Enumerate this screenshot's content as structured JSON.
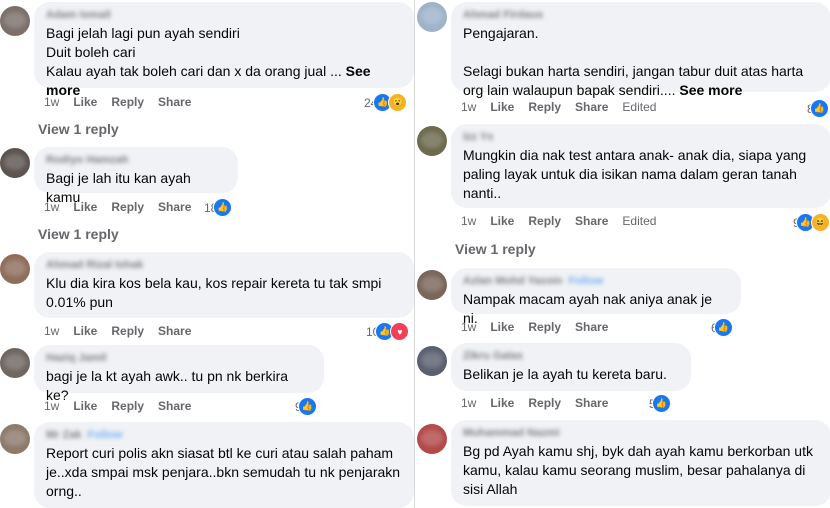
{
  "left": {
    "comments": [
      {
        "text": "Bagi jelah lagi pun ayah sendiri\nDuit boleh cari\nKalau ayah tak boleh cari dan x da orang jual ... ",
        "see_more": "See more",
        "age": "1w",
        "like": "Like",
        "reply": "Share",
        "reply_label": "Reply",
        "react_count": "24",
        "reacts": [
          "like",
          "wow"
        ],
        "view_reply": "View 1 reply"
      },
      {
        "text": "Bagi je lah itu kan ayah kamu",
        "age": "1w",
        "like": "Like",
        "reply_label": "Reply",
        "share": "Share",
        "react_count": "18",
        "reacts": [
          "like"
        ],
        "view_reply": "View 1 reply"
      },
      {
        "text": "Klu dia kira kos bela kau, kos repair kereta tu tak smpi\n0.01% pun",
        "age": "1w",
        "like": "Like",
        "reply_label": "Reply",
        "share": "Share",
        "react_count": "10",
        "reacts": [
          "like",
          "heart"
        ]
      },
      {
        "text": "bagi je la kt ayah awk.. tu pn nk berkira ke?",
        "age": "1w",
        "like": "Like",
        "reply_label": "Reply",
        "share": "Share",
        "react_count": "9",
        "reacts": [
          "like"
        ]
      },
      {
        "text": "Report curi polis akn siasat btl ke curi atau salah paham\nje..xda smpai msk penjara..bkn semudah tu nk penjarakn\norng.."
      }
    ]
  },
  "right": {
    "comments": [
      {
        "text": "Pengajaran.\n\nSelagi bukan harta sendiri, jangan tabur duit atas harta\norg lain walaupun bapak sendiri.... ",
        "see_more": "See more",
        "age": "1w",
        "like": "Like",
        "reply_label": "Reply",
        "share": "Share",
        "edited": "Edited",
        "react_count": "8",
        "reacts": [
          "like"
        ]
      },
      {
        "text": "Mungkin dia nak test antara anak- anak dia, siapa yang\npaling layak untuk dia isikan nama dalam geran tanah\nnanti..",
        "age": "1w",
        "like": "Like",
        "reply_label": "Reply",
        "share": "Share",
        "edited": "Edited",
        "react_count": "9",
        "reacts": [
          "like",
          "haha"
        ],
        "view_reply": "View 1 reply"
      },
      {
        "text": "Nampak macam ayah nak aniya anak je ni.",
        "age": "1w",
        "like": "Like",
        "reply_label": "Reply",
        "share": "Share",
        "react_count": "6",
        "reacts": [
          "like"
        ]
      },
      {
        "text": "Belikan je la ayah tu kereta baru.",
        "age": "1w",
        "like": "Like",
        "reply_label": "Reply",
        "share": "Share",
        "react_count": "5",
        "reacts": [
          "like"
        ]
      },
      {
        "text": "Bg pd Ayah kamu shj, byk dah ayah kamu berkorban utk\nkamu, kalau kamu seorang muslim, besar pahalanya di\nsisi Allah"
      }
    ]
  },
  "colors": {
    "bubble": "#f0f2f5",
    "like_blue": "#1877f2",
    "meta_gray": "#65676b",
    "heart": "#f33e58",
    "emoji": "#f7b125"
  },
  "icons": {
    "like": "thumbs-up-icon",
    "heart": "heart-icon",
    "wow": "wow-emoji-icon",
    "haha": "haha-emoji-icon"
  }
}
